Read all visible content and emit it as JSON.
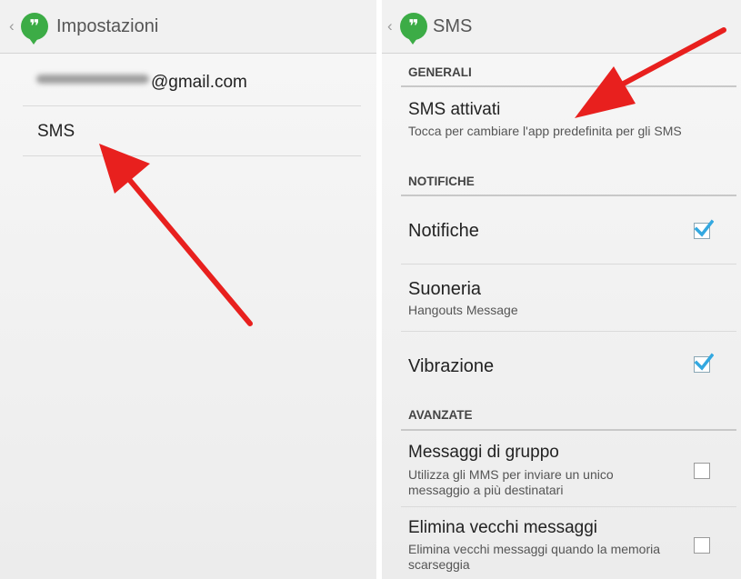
{
  "left_screen": {
    "title": "Impostazioni",
    "back_glyph": "‹",
    "logo_glyph": "❞",
    "account_email": "@gmail.com",
    "sms_label": "SMS"
  },
  "right_screen": {
    "title": "SMS",
    "back_glyph": "‹",
    "logo_glyph": "❞",
    "sections": {
      "generali": "GENERALI",
      "notifiche": "NOTIFICHE",
      "avanzate": "AVANZATE"
    },
    "items": {
      "sms_attivati": {
        "title": "SMS attivati",
        "summary": "Tocca per cambiare l'app predefinita per gli SMS"
      },
      "notifiche": {
        "title": "Notifiche",
        "checked": true
      },
      "suoneria": {
        "title": "Suoneria",
        "summary": "Hangouts Message"
      },
      "vibrazione": {
        "title": "Vibrazione",
        "checked": true
      },
      "messaggi_gruppo": {
        "title": "Messaggi di gruppo",
        "summary": "Utilizza gli MMS per inviare un unico messaggio a più destinatari",
        "checked": false
      },
      "elimina_vecchi": {
        "title": "Elimina vecchi messaggi",
        "summary": "Elimina vecchi messaggi quando la memoria scarseggia",
        "checked": false
      }
    }
  },
  "colors": {
    "hangouts_green": "#3cac46",
    "annotation_arrow": "#e8201e",
    "checkmark_blue": "#33a8e0"
  }
}
